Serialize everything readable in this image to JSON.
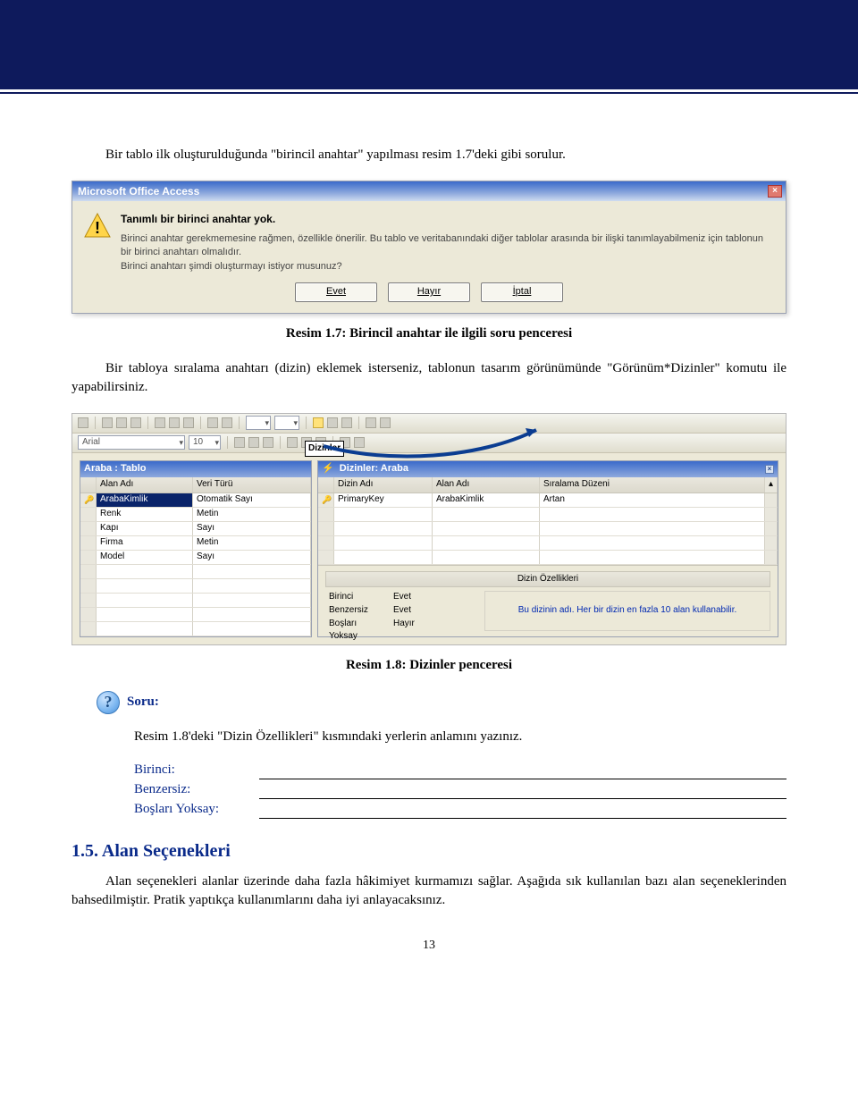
{
  "intro_para": "Bir tablo ilk oluşturulduğunda \"birincil anahtar\" yapılması resim 1.7'deki gibi sorulur.",
  "dialog": {
    "title": "Microsoft Office Access",
    "head": "Tanımlı bir birinci anahtar yok.",
    "body": "Birinci anahtar gerekmemesine rağmen, özellikle önerilir. Bu tablo ve veritabanındaki diğer tablolar arasında bir ilişki tanımlayabilmeniz için tablonun bir birinci anahtarı olmalıdır.\nBirinci anahtarı şimdi oluşturmayı istiyor musunuz?",
    "buttons": {
      "yes": "Evet",
      "no": "Hayır",
      "cancel": "İptal"
    }
  },
  "caption1": "Resim 1.7: Birincil anahtar ile ilgili soru penceresi",
  "para2": "Bir tabloya sıralama anahtarı (dizin) eklemek isterseniz, tablonun tasarım görünümünde \"Görünüm*Dizinler\" komutu ile yapabilirsiniz.",
  "toolbar": {
    "font": "Arial",
    "size": "10"
  },
  "callout": "Dizinler",
  "left_pane": {
    "title": "Araba : Tablo",
    "cols": [
      "Alan Adı",
      "Veri Türü"
    ],
    "rows": [
      [
        "ArabaKimlik",
        "Otomatik Sayı"
      ],
      [
        "Renk",
        "Metin"
      ],
      [
        "Kapı",
        "Sayı"
      ],
      [
        "Firma",
        "Metin"
      ],
      [
        "Model",
        "Sayı"
      ]
    ]
  },
  "right_pane": {
    "title": "Dizinler: Araba",
    "cols": [
      "Dizin Adı",
      "Alan Adı",
      "Sıralama Düzeni"
    ],
    "rows": [
      [
        "PrimaryKey",
        "ArabaKimlik",
        "Artan"
      ]
    ],
    "props_title": "Dizin Özellikleri",
    "props": [
      [
        "Birinci",
        "Evet"
      ],
      [
        "Benzersiz",
        "Evet"
      ],
      [
        "Boşları Yoksay",
        "Hayır"
      ]
    ],
    "hint": "Bu dizinin adı. Her bir dizin en fazla 10 alan kullanabilir."
  },
  "caption2": "Resim 1.8: Dizinler penceresi",
  "soru_label": "Soru:",
  "soru_text": "Resim 1.8'deki \"Dizin Özellikleri\" kısmındaki yerlerin anlamını yazınız.",
  "form": {
    "birinci": "Birinci:",
    "benzersiz": "Benzersiz:",
    "boslari": "Boşları Yoksay:"
  },
  "section_heading": "1.5. Alan Seçenekleri",
  "section_para": "Alan seçenekleri alanlar üzerinde daha fazla hâkimiyet kurmamızı sağlar. Aşağıda sık kullanılan bazı alan seçeneklerinden bahsedilmiştir. Pratik yaptıkça kullanımlarını daha iyi anlayacaksınız.",
  "page_number": "13"
}
